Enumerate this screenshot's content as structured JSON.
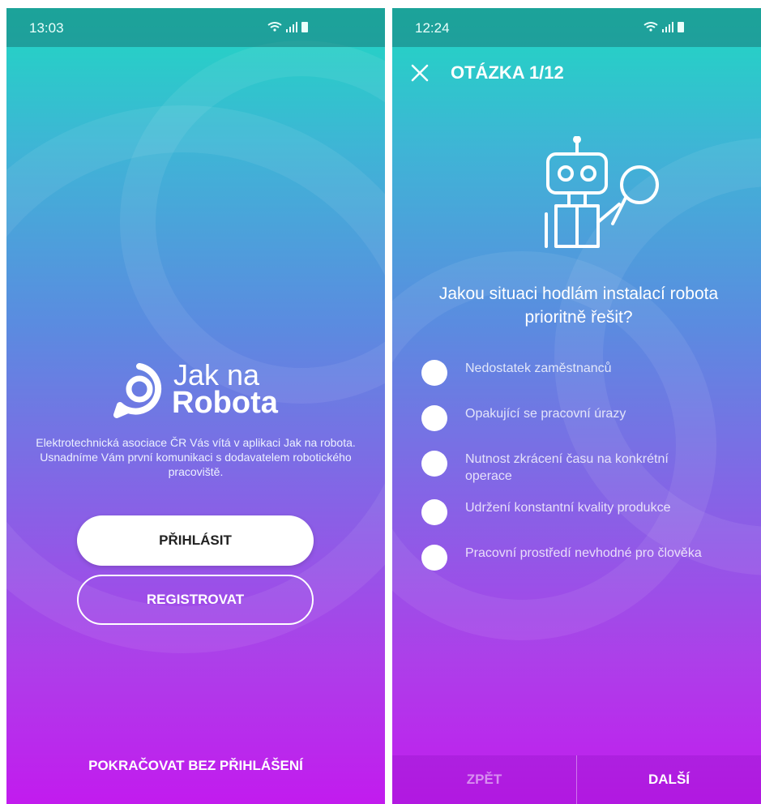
{
  "left_screen": {
    "status_time": "13:03",
    "status_icons": "wifi signal battery",
    "logo_line1": "Jak na",
    "logo_line2": "Robota",
    "intro": "Elektrotechnická asociace ČR Vás vítá v aplikaci Jak na robota. Usnadníme Vám první komunikaci s dodavatelem robotického pracoviště.",
    "login_label": "PŘIHLÁSIT",
    "register_label": "REGISTROVAT",
    "skip_label": "POKRAČOVAT BEZ PŘIHLÁŠENÍ"
  },
  "right_screen": {
    "status_time": "12:24",
    "status_icons": "wifi signal battery",
    "question_counter": "OTÁZKA 1/12",
    "question": "Jakou situaci hodlám instalací robota prioritně řešit?",
    "options": [
      "Nedostatek zaměstnanců",
      "Opakující se pracovní úrazy",
      "Nutnost zkrácení času na konkrétní operace",
      "Udržení konstantní kvality produkce",
      "Pracovní prostředí nevhodné pro člověka"
    ],
    "back_label": "ZPĚT",
    "next_label": "DALŠÍ"
  },
  "icons": [
    "close-icon",
    "logo-icon",
    "robot-icon",
    "wifi-icon",
    "signal-icon",
    "battery-icon"
  ]
}
